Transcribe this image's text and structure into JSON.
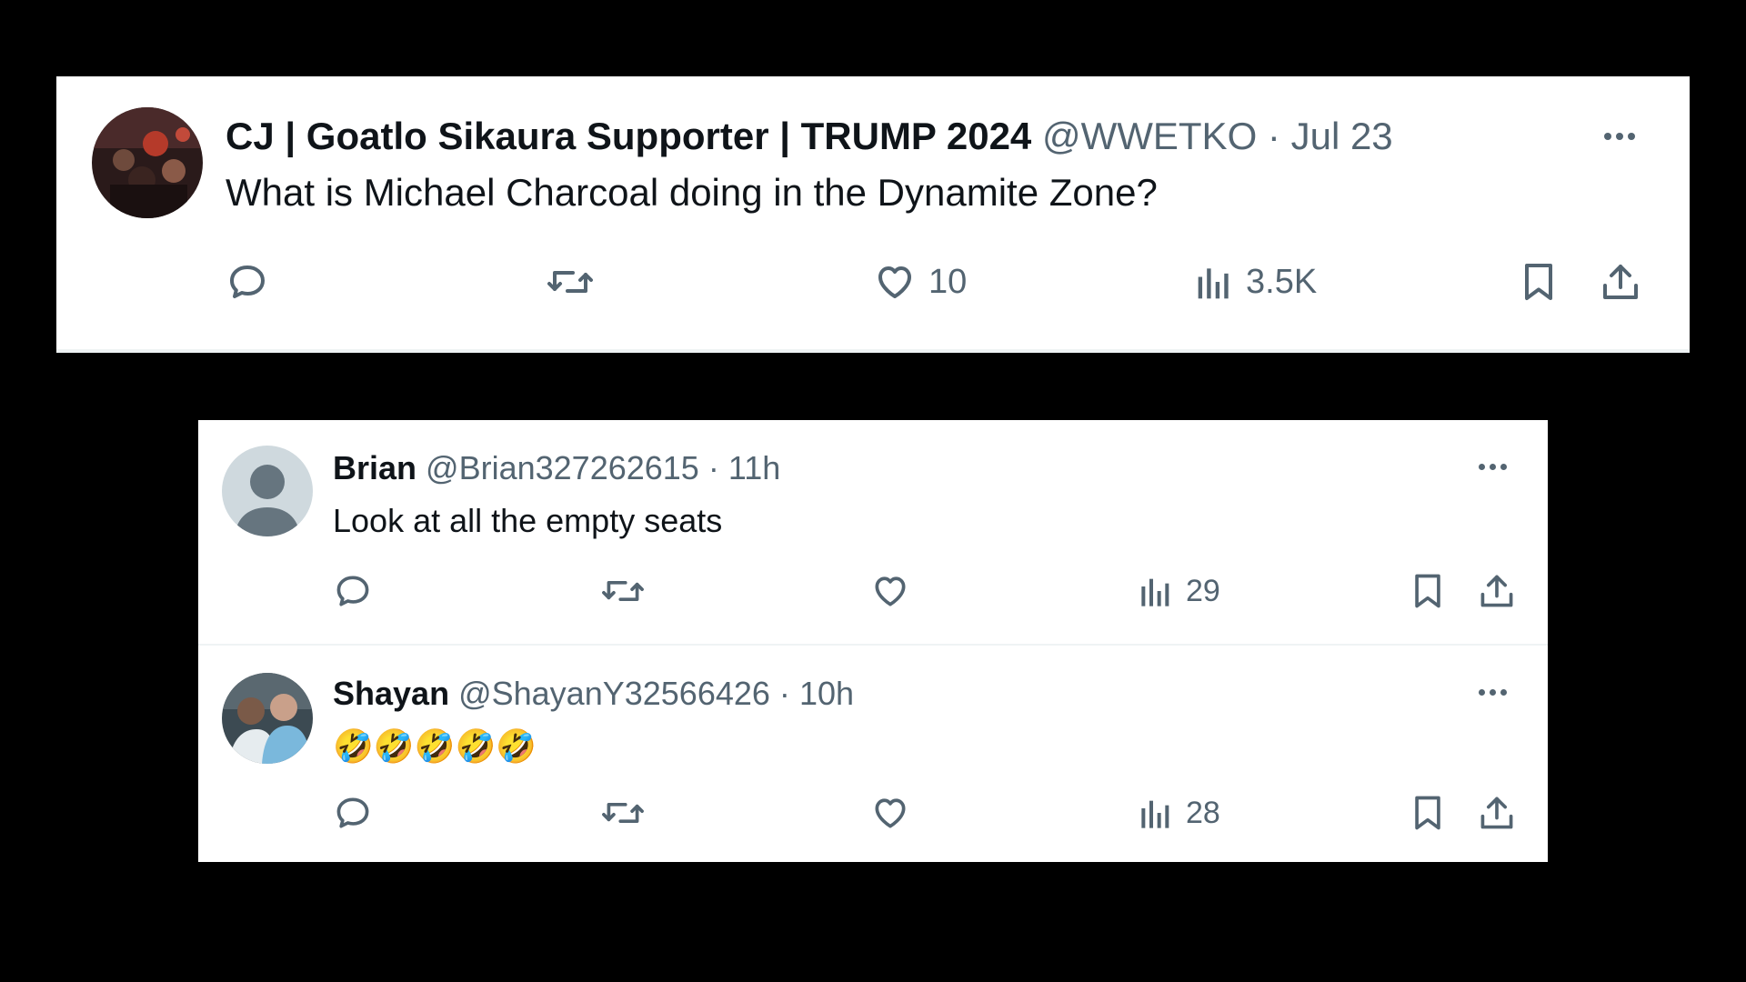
{
  "main_tweet": {
    "name": "CJ | Goatlo Sikaura Supporter | TRUMP 2024",
    "handle": "@WWETKO",
    "separator": "·",
    "date": "Jul 23",
    "text": "What is Michael Charcoal doing in the Dynamite Zone?",
    "like_count": "10",
    "view_count": "3.5K",
    "icons": [
      "reply-icon",
      "retweet-icon",
      "like-icon",
      "views-icon",
      "bookmark-icon",
      "share-icon",
      "more-icon"
    ]
  },
  "replies": [
    {
      "name": "Brian",
      "handle": "@Brian327262615",
      "separator": "·",
      "time": "11h",
      "text": "Look at all the empty seats",
      "view_count": "29"
    },
    {
      "name": "Shayan",
      "handle": "@ShayanY32566426",
      "separator": "·",
      "time": "10h",
      "text": "🤣🤣🤣🤣🤣",
      "view_count": "28"
    }
  ],
  "colors": {
    "background": "#000000",
    "card": "#ffffff",
    "text": "#0f1419",
    "secondary": "#536471",
    "divider": "#eff3f4"
  }
}
